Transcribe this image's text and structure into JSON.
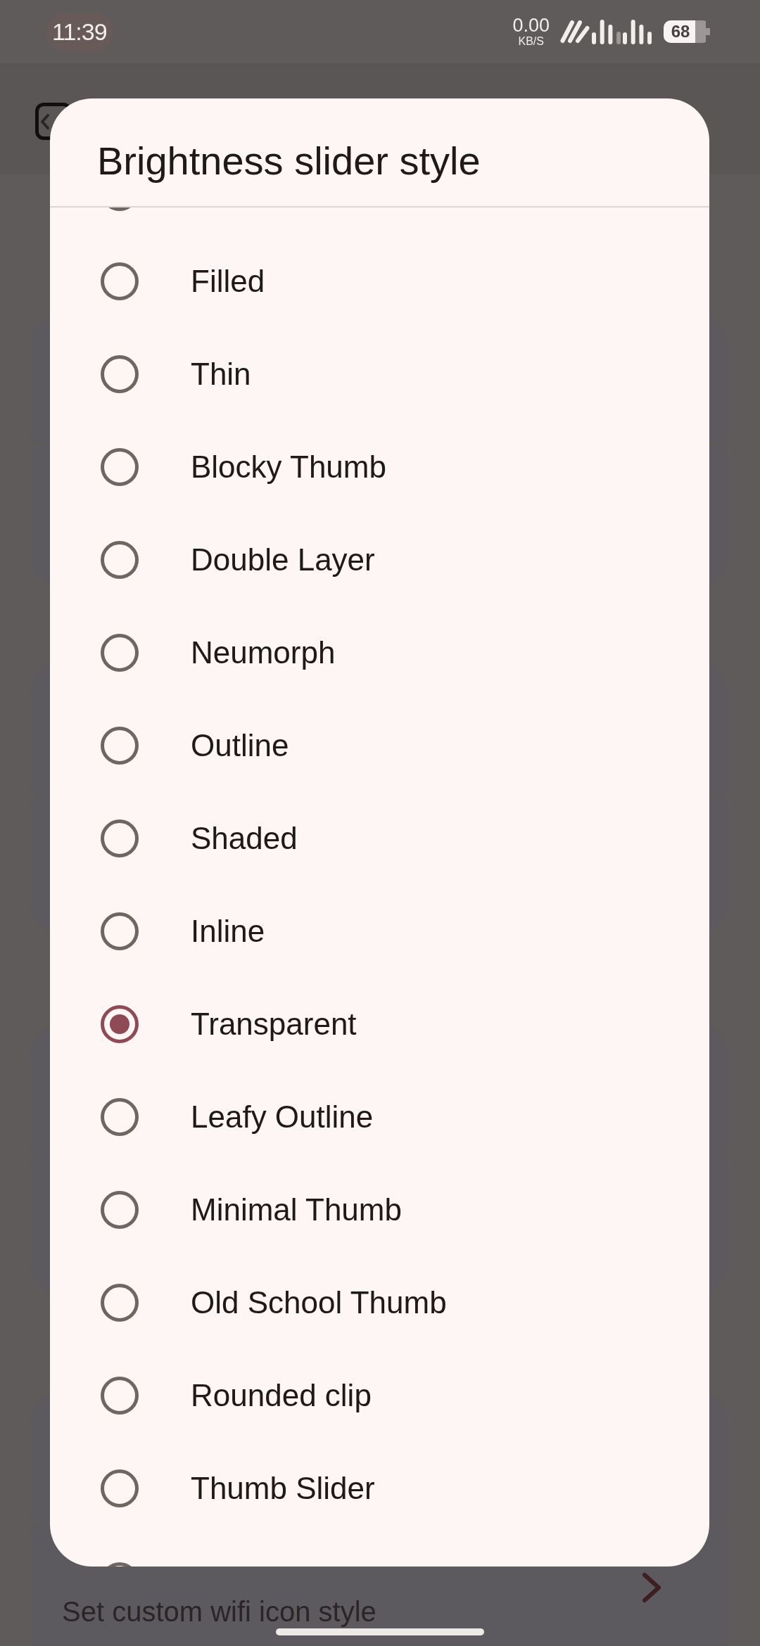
{
  "status_bar": {
    "time": "11:39",
    "net_speed": "0.00",
    "net_speed_unit": "KB/S",
    "battery": "68"
  },
  "background_page": {
    "card_subtitle": "Set custom wifi icon style"
  },
  "dialog": {
    "title": "Brightness slider style",
    "options": [
      {
        "label": "Filled",
        "selected": false
      },
      {
        "label": "Thin",
        "selected": false
      },
      {
        "label": "Blocky Thumb",
        "selected": false
      },
      {
        "label": "Double Layer",
        "selected": false
      },
      {
        "label": "Neumorph",
        "selected": false
      },
      {
        "label": "Outline",
        "selected": false
      },
      {
        "label": "Shaded",
        "selected": false
      },
      {
        "label": "Inline",
        "selected": false
      },
      {
        "label": "Transparent",
        "selected": true
      },
      {
        "label": "Leafy Outline",
        "selected": false
      },
      {
        "label": "Minimal Thumb",
        "selected": false
      },
      {
        "label": "Old School Thumb",
        "selected": false
      },
      {
        "label": "Rounded clip",
        "selected": false
      },
      {
        "label": "Thumb Slider",
        "selected": false
      }
    ]
  }
}
